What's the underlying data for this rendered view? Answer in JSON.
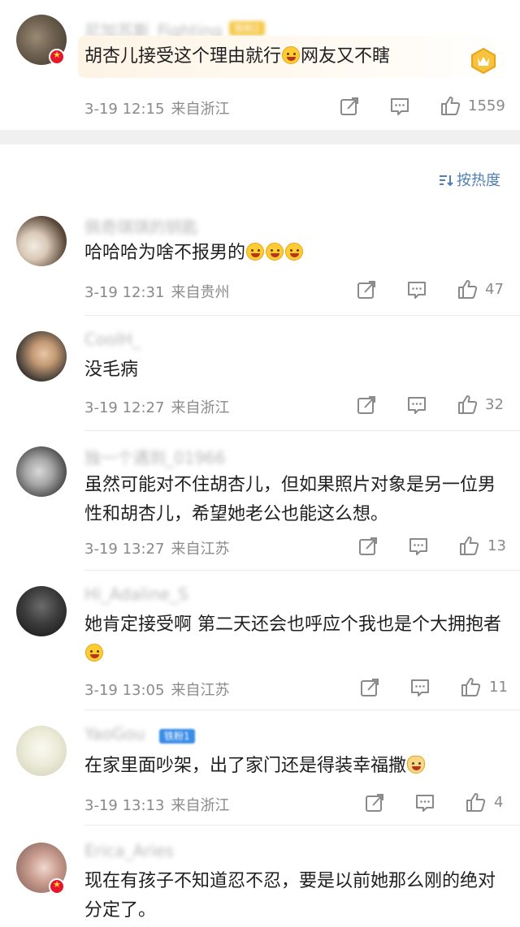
{
  "sort": {
    "label": "按热度"
  },
  "top_comment": {
    "username": "尼加苏斯_Fighting",
    "tag": "铁粉2",
    "text_parts": [
      "胡杏儿接受这个理由就行",
      "网友又不瞎"
    ],
    "time": "3-19 12:15",
    "location": "来自浙江",
    "likes": "1559"
  },
  "comments": [
    {
      "username": "佩奇琪琪的钥匙",
      "text": "哈哈哈为啥不报男的",
      "emojis": 3,
      "time": "3-19 12:31",
      "location": "来自贵州",
      "likes": "47"
    },
    {
      "username": "CoolH_",
      "text": "没毛病",
      "time": "3-19 12:27",
      "location": "来自浙江",
      "likes": "32"
    },
    {
      "username": "独一个遇到_01966",
      "text": "虽然可能对不住胡杏儿，但如果照片对象是另一位男性和胡杏儿，希望她老公也能这么想。",
      "time": "3-19 13:27",
      "location": "来自江苏",
      "likes": "13"
    },
    {
      "username": "Hi_Adaline_S",
      "text": "她肯定接受啊 第二天还会也呼应个我也是个大拥抱者",
      "emojis": 1,
      "time": "3-19 13:05",
      "location": "来自江苏",
      "likes": "11"
    },
    {
      "username": "YaoGou",
      "tag": "铁粉1",
      "text": "在家里面吵架，出了家门还是得装幸福撒",
      "emojis": 1,
      "time": "3-19 13:13",
      "location": "来自浙江",
      "likes": "4"
    },
    {
      "username": "Erica_Aries",
      "text": "现在有孩子不知道忍不忍，要是以前她那么刚的绝对分定了。"
    }
  ],
  "colors": {
    "link": "#4f7fb6",
    "meta": "#8a8a8a",
    "badge": "#e6162d"
  }
}
